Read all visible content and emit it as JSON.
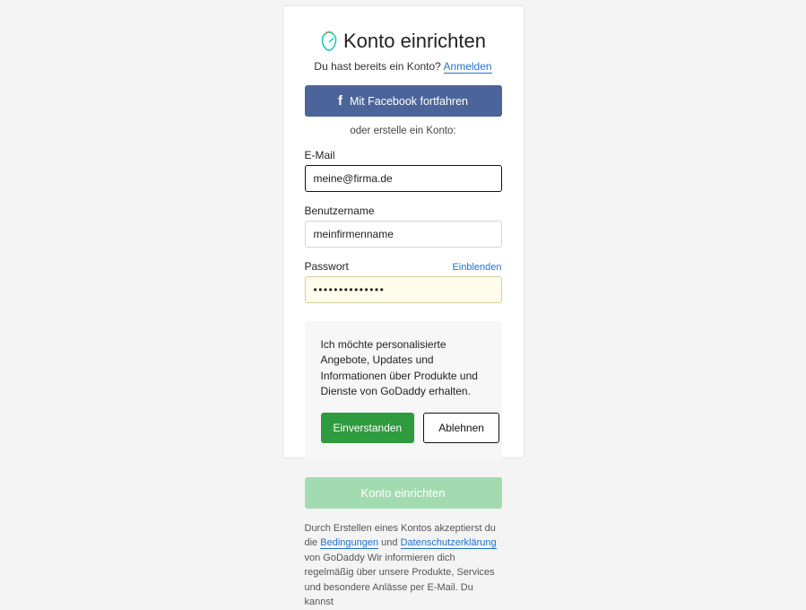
{
  "header": {
    "title": "Konto einrichten",
    "subtext": "Du hast bereits ein Konto?",
    "signin_link": "Anmelden"
  },
  "social": {
    "facebook_label": "Mit Facebook fortfahren"
  },
  "divider_text": "oder erstelle ein Konto:",
  "fields": {
    "email": {
      "label": "E-Mail",
      "value": "meine@firma.de"
    },
    "username": {
      "label": "Benutzername",
      "value": "meinfirmenname"
    },
    "password": {
      "label": "Passwort",
      "show_link": "Einblenden",
      "value": "••••••••••••••"
    }
  },
  "offers": {
    "text": "Ich möchte personalisierte Angebote, Updates und Informationen über Produkte und Dienste von GoDaddy erhalten.",
    "accept": "Einverstanden",
    "decline": "Ablehnen"
  },
  "submit": {
    "label": "Konto einrichten"
  },
  "legal": {
    "line1_pre": "Durch Erstellen eines Kontos akzeptierst du die",
    "terms": "Bedingungen",
    "and": "und",
    "privacy": "Datenschutzerklärung",
    "line1_post": "von GoDaddy",
    "line2": "Wir informieren dich regelmäßig über unsere Produkte, Services und besondere Anlässe per E-Mail. Du kannst"
  },
  "colors": {
    "facebook": "#4b659a",
    "accept": "#2f9b3f",
    "submit_disabled": "#a3dbb1",
    "link": "#1e73d6"
  }
}
